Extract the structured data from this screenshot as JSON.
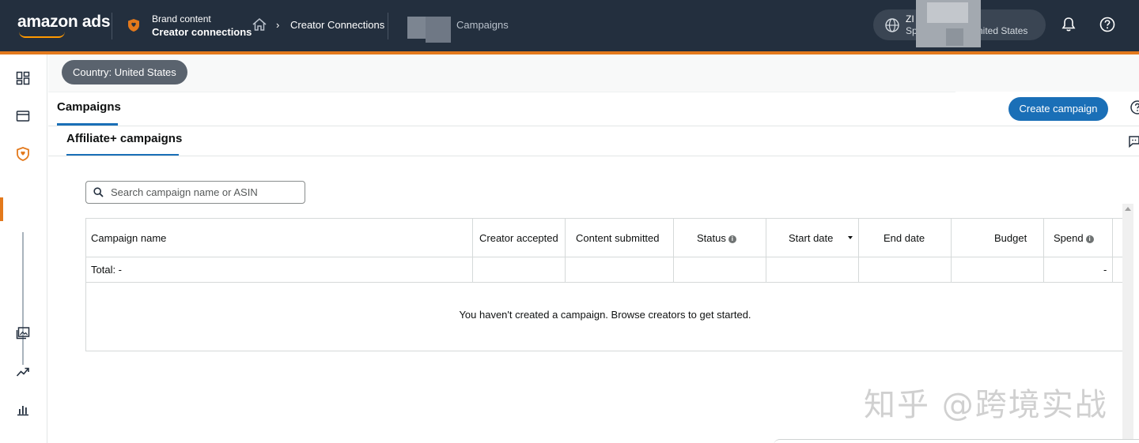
{
  "topbar": {
    "logo": "amazon ads",
    "brand_line1": "Brand content",
    "brand_line2": "Creator connections",
    "breadcrumb_sep": "›",
    "breadcrumb_creator": "Creator Connections",
    "breadcrumb_campaigns": "Campaigns",
    "account_line1": "ZI",
    "account_line2": "Sp",
    "account_country": "nited States"
  },
  "country_filter": "Country: United States",
  "tabs": {
    "campaigns": "Campaigns",
    "affiliate": "Affiliate+ campaigns"
  },
  "create_button": "Create campaign",
  "search": {
    "placeholder": "Search campaign name or ASIN"
  },
  "table": {
    "columns": [
      "Campaign name",
      "Creator accepted",
      "Content submitted",
      "Status",
      "Start date",
      "End date",
      "Budget",
      "Spend"
    ],
    "total_label": "Total: -",
    "total_spend": "-",
    "empty_message": "You haven't created a campaign. Browse creators to get started."
  },
  "info_glyph": "i",
  "watermark": "知乎 @跨境实战",
  "colors": {
    "topbar": "#232f3e",
    "accent": "#e3791c",
    "primary": "#1a6fb7"
  }
}
